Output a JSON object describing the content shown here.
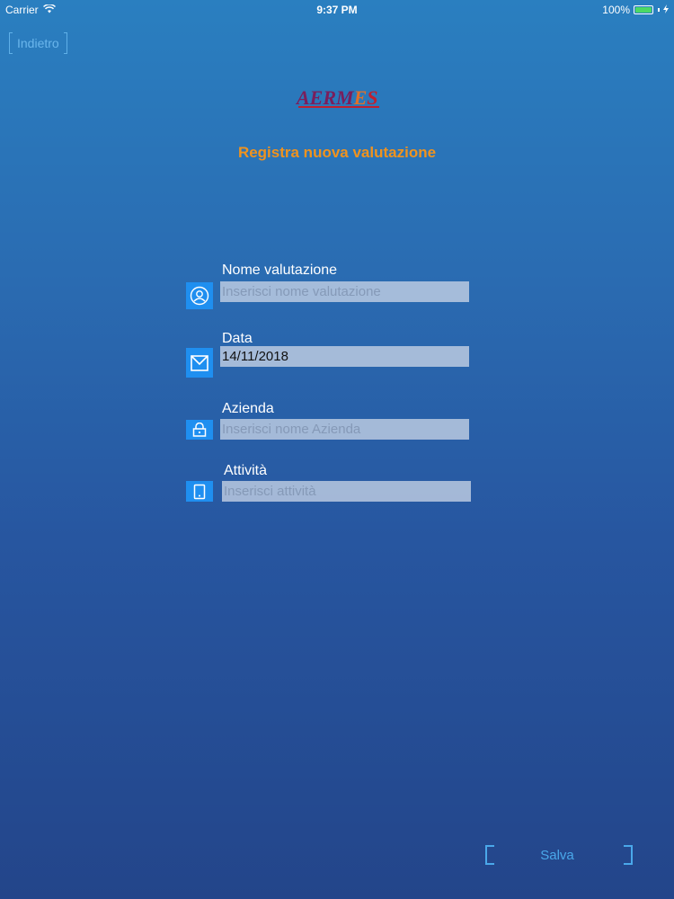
{
  "status_bar": {
    "carrier": "Carrier",
    "time": "9:37 PM",
    "battery": "100%"
  },
  "nav": {
    "back_label": "Indietro"
  },
  "logo": {
    "text_a": "AERM",
    "text_b": "E",
    "text_c": "S"
  },
  "title": "Registra nuova valutazione",
  "fields": [
    {
      "label": "Nome valutazione",
      "value": "",
      "placeholder": "Inserisci nome valutazione",
      "icon": "user-icon"
    },
    {
      "label": "Data",
      "value": "14/11/2018",
      "placeholder": "",
      "icon": "calendar-icon"
    },
    {
      "label": "Azienda",
      "value": "",
      "placeholder": "Inserisci nome Azienda",
      "icon": "lock-icon"
    },
    {
      "label": "Attività",
      "value": "",
      "placeholder": "Inserisci attività",
      "icon": "tablet-icon"
    }
  ],
  "actions": {
    "save_label": "Salva"
  },
  "colors": {
    "accent": "#f0931e",
    "icon_bg": "#1f8ff0",
    "link": "#4aa8ea"
  }
}
